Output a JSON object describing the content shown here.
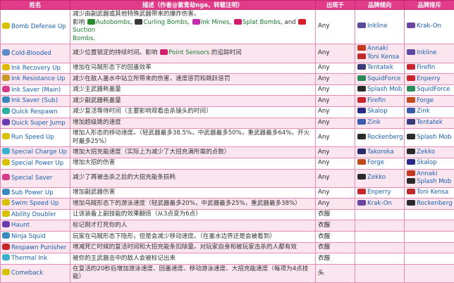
{
  "headers": [
    "姓名",
    "描述（作者@紫青劫nga，转载注明）",
    "出现于",
    "品牌倾向",
    "品牌排斥"
  ],
  "rows": [
    {
      "name": "Bomb Defense Up",
      "icon_color": "#d8c200",
      "desc_parts": [
        {
          "t": "减少由副武器或其他特殊武器带来的爆炸伤害。"
        },
        {
          "br": 1
        },
        {
          "t": "影响 "
        },
        {
          "w": "#2a8a2a"
        },
        {
          "t": "Autobombs",
          "l": 1
        },
        {
          "t": ", "
        },
        {
          "w": "#3a3a3a"
        },
        {
          "t": "Curling Bombs",
          "l": 1
        },
        {
          "t": ", "
        },
        {
          "w": "#c02ab0"
        },
        {
          "t": "Ink Mines",
          "l": 1
        },
        {
          "t": ", "
        },
        {
          "w": "#d21c6c"
        },
        {
          "t": "Splat Bombs",
          "l": 1
        },
        {
          "t": ", and "
        },
        {
          "w": "#d8202c"
        },
        {
          "t": "Suction",
          "l": 1
        },
        {
          "br": 1
        },
        {
          "t": "Bombs",
          "l": 1
        },
        {
          "t": "."
        }
      ],
      "where": "Any",
      "fav": [
        "Inkline"
      ],
      "unfav": [
        "Krak-On"
      ],
      "fav_color": [
        "#5b4a9e"
      ],
      "unfav_color": [
        "#6a46a0"
      ]
    },
    {
      "name": "Cold-Blooded",
      "icon_color": "#5b8ec8",
      "desc_parts": [
        {
          "t": "减少位置锁定的持续时间。影响 "
        },
        {
          "w": "#d21c6c"
        },
        {
          "t": "Point Sensors",
          "l": 1
        },
        {
          "t": " 的追踪时间"
        }
      ],
      "where": "Any",
      "fav": [
        "Annaki",
        "Toni Kensa"
      ],
      "unfav": [
        "Inkline"
      ],
      "fav_color": [
        "#c4381f",
        "#c02a2a"
      ],
      "unfav_color": [
        "#5b4a9e"
      ]
    },
    {
      "name": "Ink Recovery Up",
      "icon_color": "#e0b800",
      "desc_parts": [
        {
          "t": "增加在乌贼形态下的回墨效率"
        }
      ],
      "where": "Any",
      "fav": [
        "Tentatek"
      ],
      "unfav": [
        "Firefin"
      ],
      "fav_color": [
        "#3a3a7a"
      ],
      "unfav_color": [
        "#c8262c"
      ]
    },
    {
      "name": "Ink Resistance Up",
      "icon_color": "#c89a2a",
      "desc_parts": [
        {
          "t": "减少在敌人墨水中站立所带来的伤害，速度惩罚和跳跃惩罚"
        }
      ],
      "where": "Any",
      "fav": [
        "SquidForce"
      ],
      "unfav": [
        "Enperry"
      ],
      "fav_color": [
        "#2a8a5a"
      ],
      "unfav_color": [
        "#c8262c"
      ]
    },
    {
      "name": "Ink Saver (Main)",
      "icon_color": "#d83a8a",
      "desc_parts": [
        {
          "t": "减少主武器耗墨量"
        }
      ],
      "where": "Any",
      "fav": [
        "Splash Mob"
      ],
      "unfav": [
        "SquidForce"
      ],
      "fav_color": [
        "#2a2a2a"
      ],
      "unfav_color": [
        "#2a8a5a"
      ]
    },
    {
      "name": "Ink Saver (Sub)",
      "icon_color": "#3a8ac0",
      "desc_parts": [
        {
          "t": "减少副武器耗墨量"
        }
      ],
      "where": "Any",
      "fav": [
        "Firefin"
      ],
      "unfav": [
        "Forge"
      ],
      "fav_color": [
        "#c8262c"
      ],
      "unfav_color": [
        "#c04a1a"
      ]
    },
    {
      "name": "Quick Respawn",
      "icon_color": "#2ab0a0",
      "desc_parts": [
        {
          "t": "减少复活等待时间（主要影响观看击杀镜头的时间）"
        }
      ],
      "where": "Any",
      "fav": [
        "Skalop"
      ],
      "unfav": [
        "Zink"
      ],
      "fav_color": [
        "#2a2a8a"
      ],
      "unfav_color": [
        "#3a5ab0"
      ]
    },
    {
      "name": "Quick Super Jump",
      "icon_color": "#6a3ab0",
      "desc_parts": [
        {
          "t": "增加超级跳的速度"
        }
      ],
      "where": "Any",
      "fav": [
        "Zink"
      ],
      "unfav": [
        "Tentatek"
      ],
      "fav_color": [
        "#3a5ab0"
      ],
      "unfav_color": [
        "#3a3a7a"
      ]
    },
    {
      "name": "Run Speed Up",
      "icon_color": "#d8c200",
      "desc_parts": [
        {
          "t": "增加人形态的移动速度。（轻武器最多38.5%，中武器最多50%，重武器最多64%，开火时最多25%）"
        }
      ],
      "where": "Any",
      "fav": [
        "Rockenberg"
      ],
      "unfav": [
        "Splash Mob"
      ],
      "fav_color": [
        "#2a2a2a"
      ],
      "unfav_color": [
        "#2a2a2a"
      ]
    },
    {
      "name": "Special Charge Up",
      "icon_color": "#3ab0d0",
      "desc_parts": [
        {
          "t": "增加大招充能速度（实际上为减少了大招充满所需的点数）"
        }
      ],
      "where": "Any",
      "fav": [
        "Takoroka"
      ],
      "unfav": [
        "Zekko"
      ],
      "fav_color": [
        "#2a2a6a"
      ],
      "unfav_color": [
        "#2a2a2a"
      ]
    },
    {
      "name": "Special Power Up",
      "icon_color": "#d8c200",
      "desc_parts": [
        {
          "t": "增加大招的伤害"
        }
      ],
      "where": "Any",
      "fav": [
        "Forge"
      ],
      "unfav": [
        "Skalop"
      ],
      "fav_color": [
        "#c04a1a"
      ],
      "unfav_color": [
        "#2a2a8a"
      ]
    },
    {
      "name": "Special Saver",
      "icon_color": "#d83a8a",
      "desc_parts": [
        {
          "t": "减少了再被击杀之后的大招充能条损耗"
        }
      ],
      "where": "Any",
      "fav": [
        "Zekko"
      ],
      "unfav": [
        "Annaki",
        "Splash Mob"
      ],
      "fav_color": [
        "#2a2a2a"
      ],
      "unfav_color": [
        "#c4381f",
        "#2a2a2a"
      ]
    },
    {
      "name": "Sub Power Up",
      "icon_color": "#3a8ac0",
      "desc_parts": [
        {
          "t": "增加副武器伤害"
        }
      ],
      "where": "Any",
      "fav": [
        "Enperry"
      ],
      "unfav": [
        "Toni Kensa"
      ],
      "fav_color": [
        "#c8262c"
      ],
      "unfav_color": [
        "#c02a2a"
      ]
    },
    {
      "name": "Swim Speed Up",
      "icon_color": "#d8c200",
      "desc_parts": [
        {
          "t": "增加乌贼形态下的游泳速度（轻武器最多20%，中武器最多25%，重武器最多38%）"
        }
      ],
      "where": "Any",
      "fav": [
        "Krak-On"
      ],
      "unfav": [
        "Rockenberg"
      ],
      "fav_color": [
        "#6a46a0"
      ],
      "unfav_color": [
        "#2a2a2a"
      ]
    },
    {
      "name": "Ability Doubler",
      "icon_color": "#d8c200",
      "desc_parts": [
        {
          "t": "让该装备上副技能的效果翻倍（从3点变为6点）"
        }
      ],
      "where": "衣服",
      "fav": [],
      "unfav": [],
      "fav_color": [],
      "unfav_color": []
    },
    {
      "name": "Haunt",
      "icon_color": "#6a3ab0",
      "desc_parts": [
        {
          "t": "标记刚才打死你的人"
        }
      ],
      "where": "衣服",
      "fav": [],
      "unfav": [],
      "fav_color": [],
      "unfav_color": []
    },
    {
      "name": "Ninja Squid",
      "icon_color": "#3a8ac0",
      "desc_parts": [
        {
          "t": "玩家在乌贼形态下隐形，但是会减少移动速度。（在墨水边界还是会被看到）"
        }
      ],
      "where": "衣服",
      "fav": [],
      "unfav": [],
      "fav_color": [],
      "unfav_color": []
    },
    {
      "name": "Respawn Punisher",
      "icon_color": "#c8262c",
      "desc_parts": [
        {
          "t": "增减死亡时候的复活时间和大招充能条扣除量。对玩家自身和被玩家击杀的人都有效"
        }
      ],
      "where": "衣服",
      "fav": [],
      "unfav": [],
      "fav_color": [],
      "unfav_color": []
    },
    {
      "name": "Thermal Ink",
      "icon_color": "#3ab0d0",
      "desc_parts": [
        {
          "t": "被你的主武器击中的敌人会被标记出来"
        }
      ],
      "where": "衣服",
      "fav": [],
      "unfav": [],
      "fav_color": [],
      "unfav_color": []
    },
    {
      "name": "Comeback",
      "icon_color": "#d8c200",
      "desc_parts": [
        {
          "t": "在复活的20秒后增加游泳速度、回墨速度、移动游泳速度、大招充能速度（每项为4点技能）"
        }
      ],
      "where": "头",
      "fav": [],
      "unfav": [],
      "fav_color": [],
      "unfav_color": []
    }
  ]
}
